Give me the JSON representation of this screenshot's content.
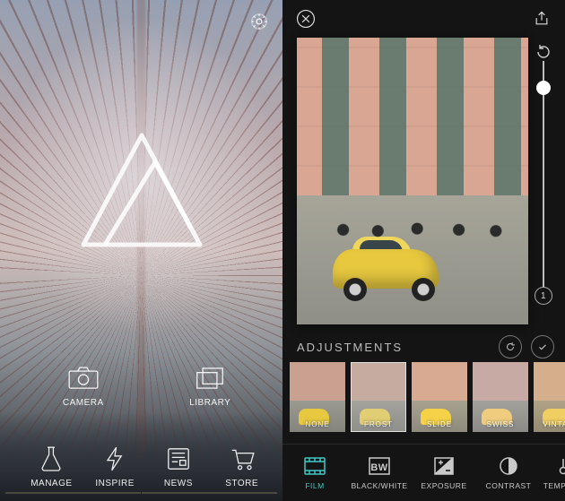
{
  "left": {
    "menu": {
      "camera": "CAMERA",
      "library": "LIBRARY",
      "manage": "MANAGE",
      "inspire": "INSPIRE",
      "news": "NEWS",
      "store": "STORE"
    }
  },
  "right": {
    "slider": {
      "value": 85,
      "badge": "1"
    },
    "section_title": "ADJUSTMENTS",
    "filters": [
      {
        "label": "NONE"
      },
      {
        "label": "FROST"
      },
      {
        "label": "SLIDE"
      },
      {
        "label": "SWISS"
      },
      {
        "label": "VINTAGE"
      }
    ],
    "selected_filter": 1,
    "tools": [
      {
        "label": "FILM",
        "active": true
      },
      {
        "label": "BLACK/WHITE",
        "active": false
      },
      {
        "label": "EXPOSURE",
        "active": false
      },
      {
        "label": "CONTRAST",
        "active": false
      },
      {
        "label": "TEMPERA",
        "active": false
      }
    ]
  }
}
